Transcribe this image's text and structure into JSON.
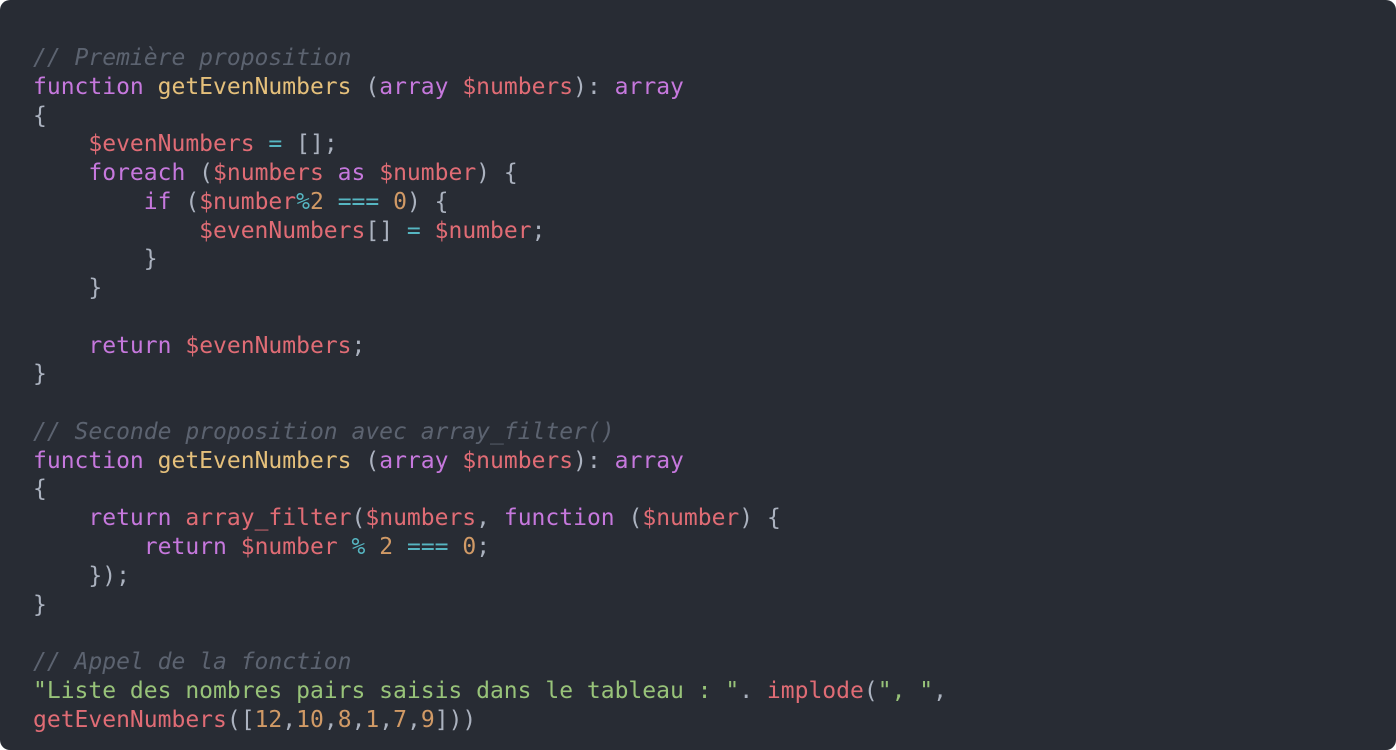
{
  "editor": {
    "background": "#282c34",
    "theme_colors": {
      "comment": "#5c6370",
      "keyword": "#c678dd",
      "function": "#e5c07b",
      "variable": "#e06c75",
      "operator": "#56b6c2",
      "number": "#d19a66",
      "string": "#98c379",
      "punctuation": "#abb2bf"
    },
    "lines": [
      [
        {
          "t": "comment",
          "v": "// Première proposition"
        }
      ],
      [
        {
          "t": "keyword",
          "v": "function"
        },
        {
          "t": "plain",
          "v": " "
        },
        {
          "t": "func",
          "v": "getEvenNumbers"
        },
        {
          "t": "punc",
          "v": " ("
        },
        {
          "t": "keyword",
          "v": "array"
        },
        {
          "t": "plain",
          "v": " "
        },
        {
          "t": "var",
          "v": "$numbers"
        },
        {
          "t": "punc",
          "v": "): "
        },
        {
          "t": "keyword",
          "v": "array"
        }
      ],
      [
        {
          "t": "punc",
          "v": "{"
        }
      ],
      [
        {
          "t": "plain",
          "v": "    "
        },
        {
          "t": "var",
          "v": "$evenNumbers"
        },
        {
          "t": "plain",
          "v": " "
        },
        {
          "t": "op",
          "v": "="
        },
        {
          "t": "plain",
          "v": " "
        },
        {
          "t": "punc",
          "v": "[];"
        }
      ],
      [
        {
          "t": "plain",
          "v": "    "
        },
        {
          "t": "keyword",
          "v": "foreach"
        },
        {
          "t": "punc",
          "v": " ("
        },
        {
          "t": "var",
          "v": "$numbers"
        },
        {
          "t": "plain",
          "v": " "
        },
        {
          "t": "keyword",
          "v": "as"
        },
        {
          "t": "plain",
          "v": " "
        },
        {
          "t": "var",
          "v": "$number"
        },
        {
          "t": "punc",
          "v": ") {"
        }
      ],
      [
        {
          "t": "plain",
          "v": "        "
        },
        {
          "t": "keyword",
          "v": "if"
        },
        {
          "t": "punc",
          "v": " ("
        },
        {
          "t": "var",
          "v": "$number"
        },
        {
          "t": "op",
          "v": "%"
        },
        {
          "t": "num",
          "v": "2"
        },
        {
          "t": "plain",
          "v": " "
        },
        {
          "t": "op",
          "v": "==="
        },
        {
          "t": "plain",
          "v": " "
        },
        {
          "t": "num",
          "v": "0"
        },
        {
          "t": "punc",
          "v": ") {"
        }
      ],
      [
        {
          "t": "plain",
          "v": "            "
        },
        {
          "t": "var",
          "v": "$evenNumbers"
        },
        {
          "t": "punc",
          "v": "[]"
        },
        {
          "t": "plain",
          "v": " "
        },
        {
          "t": "op",
          "v": "="
        },
        {
          "t": "plain",
          "v": " "
        },
        {
          "t": "var",
          "v": "$number"
        },
        {
          "t": "punc",
          "v": ";"
        }
      ],
      [
        {
          "t": "plain",
          "v": "        "
        },
        {
          "t": "punc",
          "v": "}"
        }
      ],
      [
        {
          "t": "plain",
          "v": "    "
        },
        {
          "t": "punc",
          "v": "}"
        }
      ],
      [],
      [
        {
          "t": "plain",
          "v": "    "
        },
        {
          "t": "keyword",
          "v": "return"
        },
        {
          "t": "plain",
          "v": " "
        },
        {
          "t": "var",
          "v": "$evenNumbers"
        },
        {
          "t": "punc",
          "v": ";"
        }
      ],
      [
        {
          "t": "punc",
          "v": "}"
        }
      ],
      [],
      [
        {
          "t": "comment",
          "v": "// Seconde proposition avec array_filter()"
        }
      ],
      [
        {
          "t": "keyword",
          "v": "function"
        },
        {
          "t": "plain",
          "v": " "
        },
        {
          "t": "func",
          "v": "getEvenNumbers"
        },
        {
          "t": "punc",
          "v": " ("
        },
        {
          "t": "keyword",
          "v": "array"
        },
        {
          "t": "plain",
          "v": " "
        },
        {
          "t": "var",
          "v": "$numbers"
        },
        {
          "t": "punc",
          "v": "): "
        },
        {
          "t": "keyword",
          "v": "array"
        }
      ],
      [
        {
          "t": "punc",
          "v": "{"
        }
      ],
      [
        {
          "t": "plain",
          "v": "    "
        },
        {
          "t": "keyword",
          "v": "return"
        },
        {
          "t": "plain",
          "v": " "
        },
        {
          "t": "call",
          "v": "array_filter"
        },
        {
          "t": "punc",
          "v": "("
        },
        {
          "t": "var",
          "v": "$numbers"
        },
        {
          "t": "punc",
          "v": ", "
        },
        {
          "t": "keyword",
          "v": "function"
        },
        {
          "t": "punc",
          "v": " ("
        },
        {
          "t": "var",
          "v": "$number"
        },
        {
          "t": "punc",
          "v": ") {"
        }
      ],
      [
        {
          "t": "plain",
          "v": "        "
        },
        {
          "t": "keyword",
          "v": "return"
        },
        {
          "t": "plain",
          "v": " "
        },
        {
          "t": "var",
          "v": "$number"
        },
        {
          "t": "plain",
          "v": " "
        },
        {
          "t": "op",
          "v": "%"
        },
        {
          "t": "plain",
          "v": " "
        },
        {
          "t": "num",
          "v": "2"
        },
        {
          "t": "plain",
          "v": " "
        },
        {
          "t": "op",
          "v": "==="
        },
        {
          "t": "plain",
          "v": " "
        },
        {
          "t": "num",
          "v": "0"
        },
        {
          "t": "punc",
          "v": ";"
        }
      ],
      [
        {
          "t": "plain",
          "v": "    "
        },
        {
          "t": "punc",
          "v": "});"
        }
      ],
      [
        {
          "t": "punc",
          "v": "}"
        }
      ],
      [],
      [
        {
          "t": "comment",
          "v": "// Appel de la fonction"
        }
      ],
      [
        {
          "t": "str",
          "v": "\"Liste des nombres pairs saisis dans le tableau : \""
        },
        {
          "t": "punc",
          "v": ". "
        },
        {
          "t": "call",
          "v": "implode"
        },
        {
          "t": "punc",
          "v": "("
        },
        {
          "t": "str",
          "v": "\", \""
        },
        {
          "t": "punc",
          "v": ","
        }
      ],
      [
        {
          "t": "call",
          "v": "getEvenNumbers"
        },
        {
          "t": "punc",
          "v": "(["
        },
        {
          "t": "num",
          "v": "12"
        },
        {
          "t": "punc",
          "v": ","
        },
        {
          "t": "num",
          "v": "10"
        },
        {
          "t": "punc",
          "v": ","
        },
        {
          "t": "num",
          "v": "8"
        },
        {
          "t": "punc",
          "v": ","
        },
        {
          "t": "num",
          "v": "1"
        },
        {
          "t": "punc",
          "v": ","
        },
        {
          "t": "num",
          "v": "7"
        },
        {
          "t": "punc",
          "v": ","
        },
        {
          "t": "num",
          "v": "9"
        },
        {
          "t": "punc",
          "v": "]))"
        }
      ]
    ]
  }
}
